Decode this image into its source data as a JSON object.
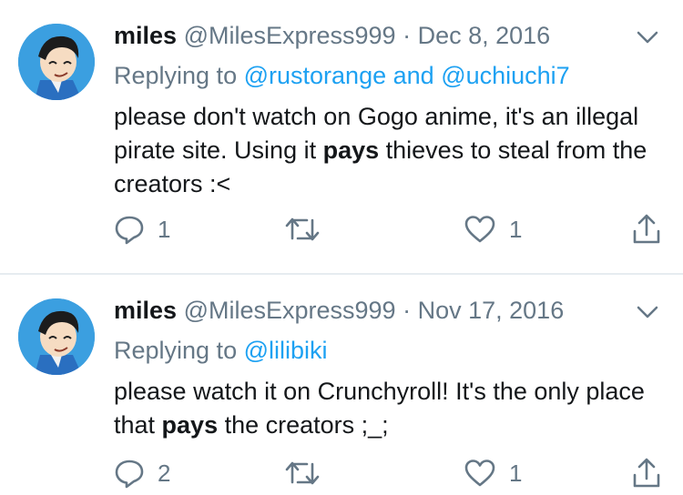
{
  "tweets": [
    {
      "name": "miles",
      "handle": "@MilesExpress999",
      "separator": "·",
      "date": "Dec 8, 2016",
      "replying_prefix": "Replying to",
      "mention_1": "@rustorange",
      "mention_join": "and",
      "mention_2": "@uchiuchi7",
      "text_before": "please don't watch on Gogo anime, it's an illegal pirate site. Using it ",
      "text_bold": "pays",
      "text_after": " thieves to steal from the creators :<",
      "reply_count": "1",
      "like_count": "1"
    },
    {
      "name": "miles",
      "handle": "@MilesExpress999",
      "separator": "·",
      "date": "Nov 17, 2016",
      "replying_prefix": "Replying to",
      "mention_1": "@lilibiki",
      "text_before": "please watch it on Crunchyroll! It's the only place that ",
      "text_bold": "pays",
      "text_after": " the creators ;_;",
      "reply_count": "2",
      "like_count": "1"
    }
  ],
  "icons": {
    "reply": "speech-bubble-icon",
    "retweet": "retweet-icon",
    "like": "heart-icon",
    "share": "share-icon",
    "menu": "chevron-down-icon"
  },
  "colors": {
    "text": "#14171a",
    "secondary": "#657786",
    "link": "#1da1f2",
    "avatar_bg": "#3b9fe0",
    "divider": "#e6ecf0"
  }
}
